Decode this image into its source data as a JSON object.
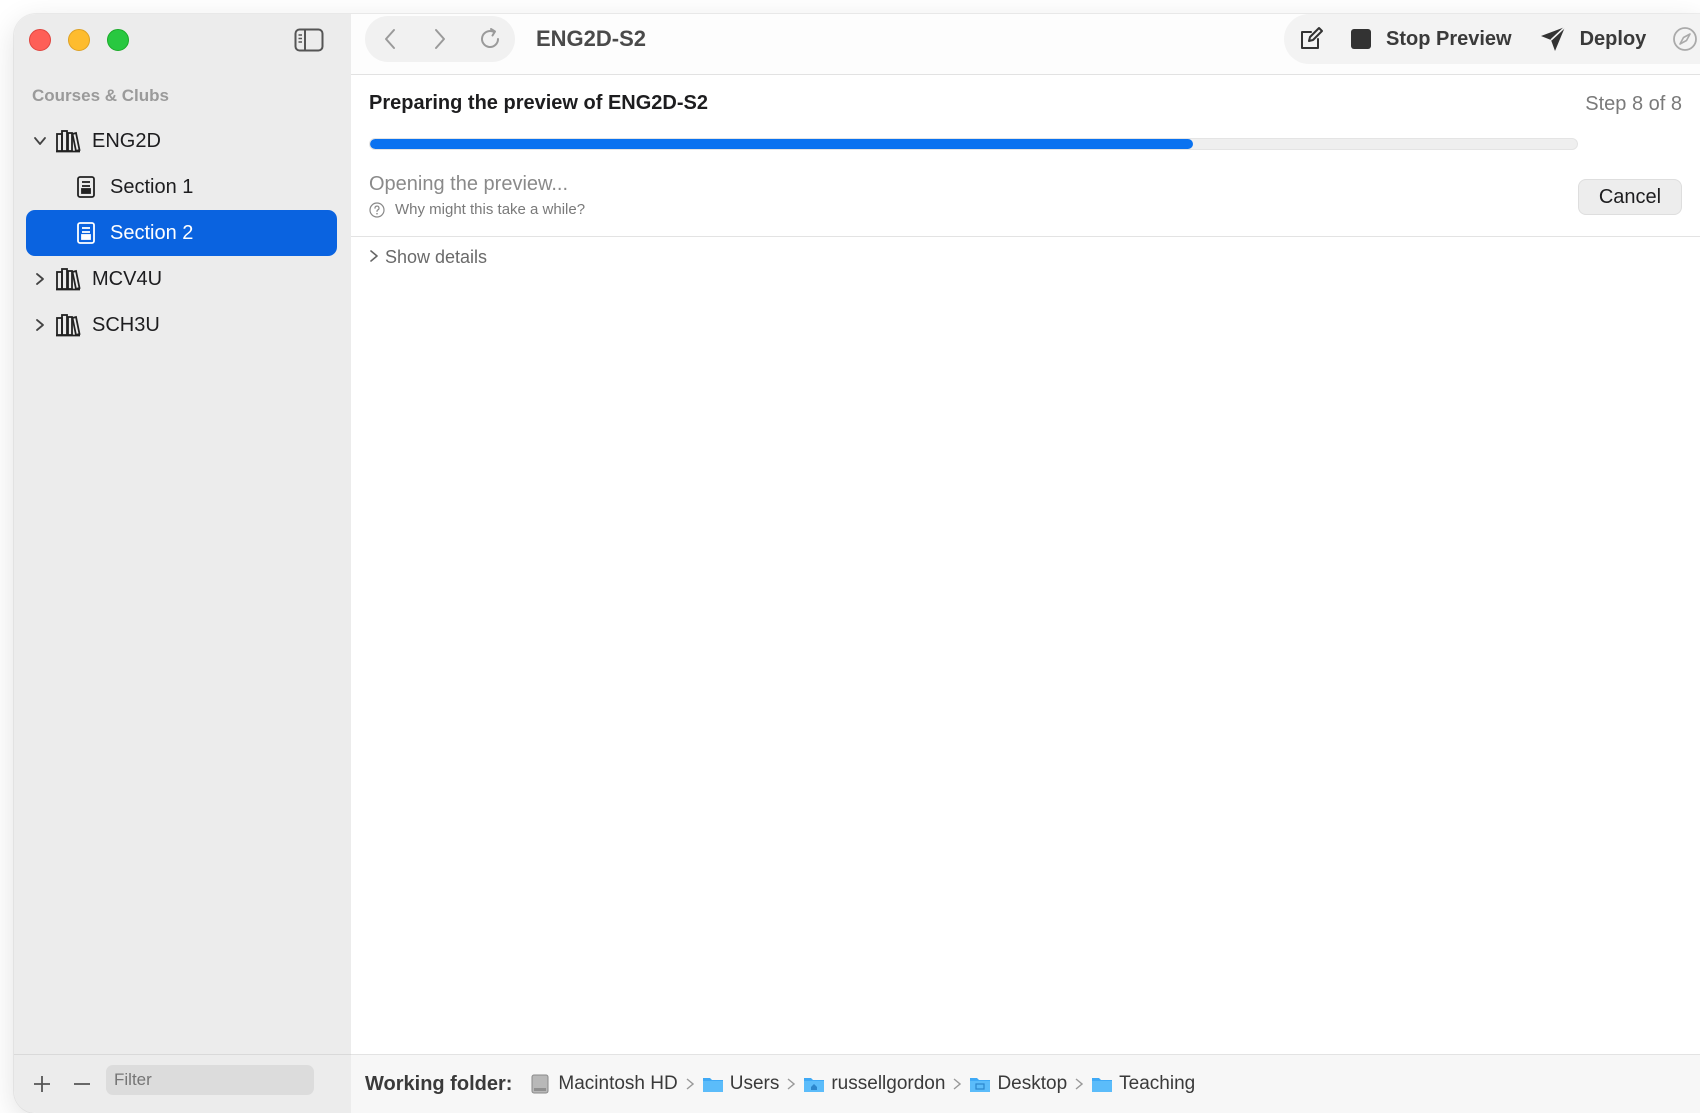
{
  "window": {
    "title": "ENG2D-S2"
  },
  "sidebar": {
    "header": "Courses & Clubs",
    "items": [
      {
        "label": "ENG2D",
        "expanded": true,
        "icon": "books-icon"
      },
      {
        "label": "Section 1",
        "icon": "section-icon"
      },
      {
        "label": "Section 2",
        "icon": "section-icon",
        "selected": true
      },
      {
        "label": "MCV4U",
        "expanded": false,
        "icon": "books-icon"
      },
      {
        "label": "SCH3U",
        "expanded": false,
        "icon": "books-icon"
      }
    ],
    "filter_placeholder": "Filter"
  },
  "toolbar": {
    "stop_preview_label": "Stop Preview",
    "deploy_label": "Deploy"
  },
  "content": {
    "title": "Preparing the preview of ENG2D-S2",
    "step": "Step 8 of 8",
    "progress_percent": 68.2,
    "status": "Opening the preview...",
    "why_link": "Why might this take a while?",
    "cancel_label": "Cancel",
    "show_details": "Show details"
  },
  "footer": {
    "label": "Working folder:",
    "path": [
      "Macintosh HD",
      "Users",
      "russellgordon",
      "Desktop",
      "Teaching"
    ]
  },
  "colors": {
    "accent": "#0a63e0",
    "progress": "#0a72f0",
    "folder": "#3fa9f5"
  }
}
